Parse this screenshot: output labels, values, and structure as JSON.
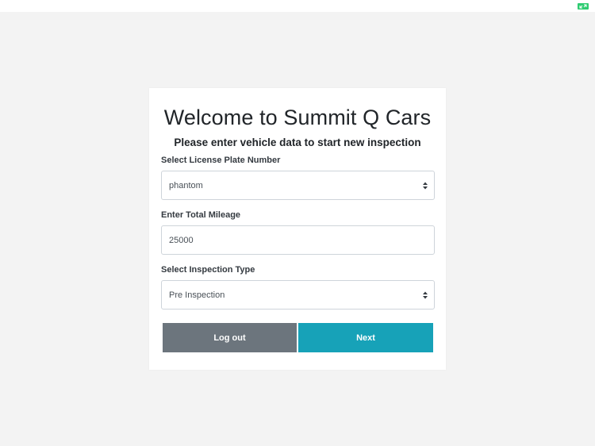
{
  "card": {
    "title": "Welcome to Summit Q Cars",
    "subtitle": "Please enter vehicle data to start new inspection"
  },
  "form": {
    "license_plate": {
      "label": "Select License Plate Number",
      "value": "phantom"
    },
    "mileage": {
      "label": "Enter Total Mileage",
      "value": "25000"
    },
    "inspection_type": {
      "label": "Select Inspection Type",
      "value": "Pre Inspection"
    }
  },
  "buttons": {
    "logout_label": "Log out",
    "next_label": "Next"
  },
  "icons": {
    "fullscreen": "fullscreen-toggle-icon",
    "select_arrow": "select-arrows-icon"
  },
  "colors": {
    "background": "#f3f3f3",
    "card": "#ffffff",
    "logout_button": "#6c757d",
    "next_button": "#17a2b8",
    "fullscreen_icon": "#2ecc71"
  }
}
